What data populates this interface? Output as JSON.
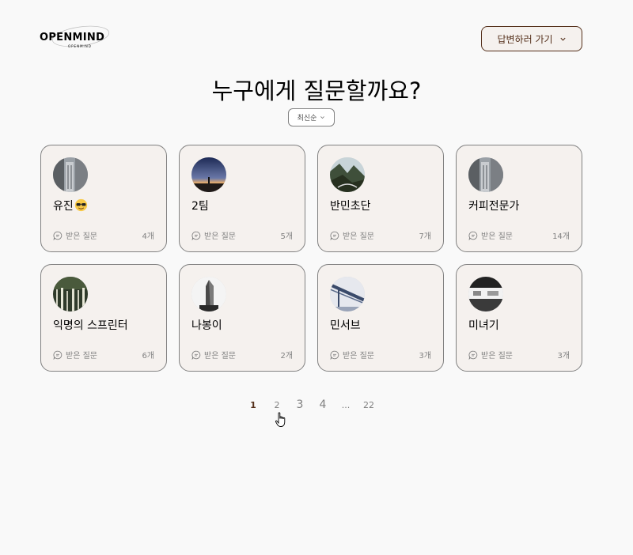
{
  "header": {
    "logo_text": "OPENMIND",
    "logo_subtext": "OPENMIND",
    "answer_button_label": "답변하러 가기"
  },
  "main": {
    "title": "누구에게 질문할까요?",
    "sort_label": "최신순",
    "cards": [
      {
        "name": "유진",
        "has_emoji": true,
        "question_label": "받은 질문",
        "count": "4개",
        "avatar": "building-icon"
      },
      {
        "name": "2팀",
        "has_emoji": false,
        "question_label": "받은 질문",
        "count": "5개",
        "avatar": "sunset-icon"
      },
      {
        "name": "반민초단",
        "has_emoji": false,
        "question_label": "받은 질문",
        "count": "7개",
        "avatar": "mountain-icon"
      },
      {
        "name": "커피전문가",
        "has_emoji": false,
        "question_label": "받은 질문",
        "count": "14개",
        "avatar": "building-icon"
      },
      {
        "name": "익명의 스프린터",
        "has_emoji": false,
        "question_label": "받은 질문",
        "count": "6개",
        "avatar": "forest-icon"
      },
      {
        "name": "나봉이",
        "has_emoji": false,
        "question_label": "받은 질문",
        "count": "2개",
        "avatar": "flatiron-icon"
      },
      {
        "name": "민서브",
        "has_emoji": false,
        "question_label": "받은 질문",
        "count": "3개",
        "avatar": "bridge-icon"
      },
      {
        "name": "미녀기",
        "has_emoji": false,
        "question_label": "받은 질문",
        "count": "3개",
        "avatar": "street-icon"
      }
    ]
  },
  "pagination": {
    "pages": [
      "1",
      "2",
      "3",
      "4",
      "...",
      "22"
    ],
    "current": "1"
  },
  "colors": {
    "brown": "#542f1a",
    "card_bg": "#f5f1ee",
    "gray": "#818181",
    "bg": "#f9f9f9"
  }
}
